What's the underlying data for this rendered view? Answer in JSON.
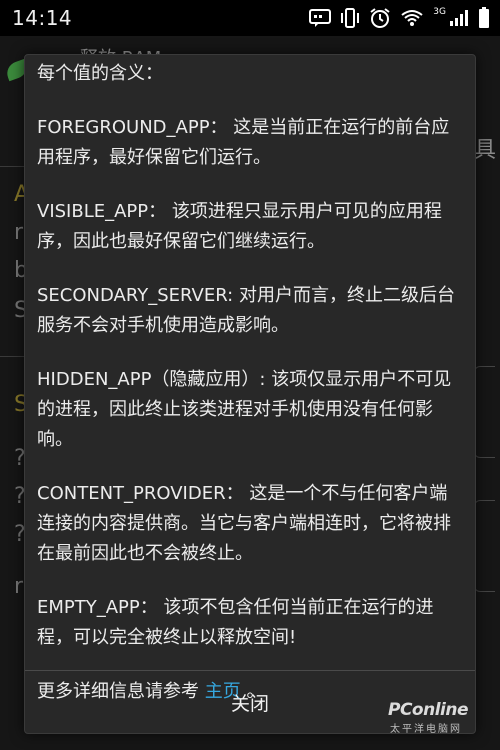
{
  "status_bar": {
    "time": "14:14",
    "network_label": "3G",
    "icons": [
      "message-icon",
      "vibrate-icon",
      "alarm-icon",
      "wifi-icon",
      "signal-icon",
      "battery-icon"
    ]
  },
  "background_app": {
    "title": "释放 RAM",
    "side_text": "具",
    "letters": [
      "A",
      "r",
      "b",
      "S",
      "S",
      "?",
      "?",
      "?",
      "r"
    ]
  },
  "dialog": {
    "heading": "每个值的含义：",
    "items": [
      {
        "text": "FOREGROUND_APP： 这是当前正在运行的前台应用程序，最好保留它们运行。"
      },
      {
        "text": "VISIBLE_APP： 该项进程只显示用户可见的应用程序，因此也最好保留它们继续运行。"
      },
      {
        "text": "SECONDARY_SERVER: 对用户而言，终止二级后台服务不会对手机使用造成影响。"
      },
      {
        "text": "HIDDEN_APP（隐藏应用）: 该项仅显示用户不可见的进程，因此终止该类进程对手机使用没有任何影响。"
      },
      {
        "text": "CONTENT_PROVIDER： 这是一个不与任何客户端连接的内容提供商。当它与客户端相连时，它将被排在最前因此也不会被终止。"
      },
      {
        "text": "EMPTY_APP： 该项不包含任何当前正在运行的进程，可以完全被终止以释放空间!"
      }
    ],
    "more_info_prefix": "更多详细信息请参考 ",
    "more_info_link": "主页",
    "more_info_suffix": " 。",
    "close_label": "关闭"
  },
  "watermark": {
    "brand": "PConline",
    "subtitle": "太平洋电脑网"
  },
  "colors": {
    "dialog_bg": "#282828",
    "link": "#36a8e0",
    "text": "#ececec"
  }
}
